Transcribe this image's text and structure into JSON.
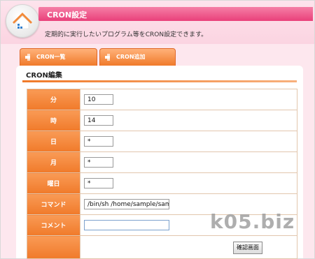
{
  "header": {
    "title": "CRON設定",
    "description": "定期的に実行したいプログラム等をCRON設定できます。"
  },
  "tabs": [
    {
      "label": "CRON一覧"
    },
    {
      "label": "CRON追加"
    }
  ],
  "section": {
    "title": "CRON編集"
  },
  "form": {
    "minute": {
      "label": "分",
      "value": "10"
    },
    "hour": {
      "label": "時",
      "value": "14"
    },
    "day": {
      "label": "日",
      "value": "*"
    },
    "month": {
      "label": "月",
      "value": "*"
    },
    "weekday": {
      "label": "曜日",
      "value": "*"
    },
    "command": {
      "label": "コマンド",
      "value": "/bin/sh /home/sample/samp"
    },
    "comment": {
      "label": "コメント",
      "value": ""
    },
    "confirm_button": "確認画面"
  },
  "watermark": "k05.biz",
  "colors": {
    "accent_orange": "#f07a2a",
    "header_pink": "#e9407a"
  }
}
